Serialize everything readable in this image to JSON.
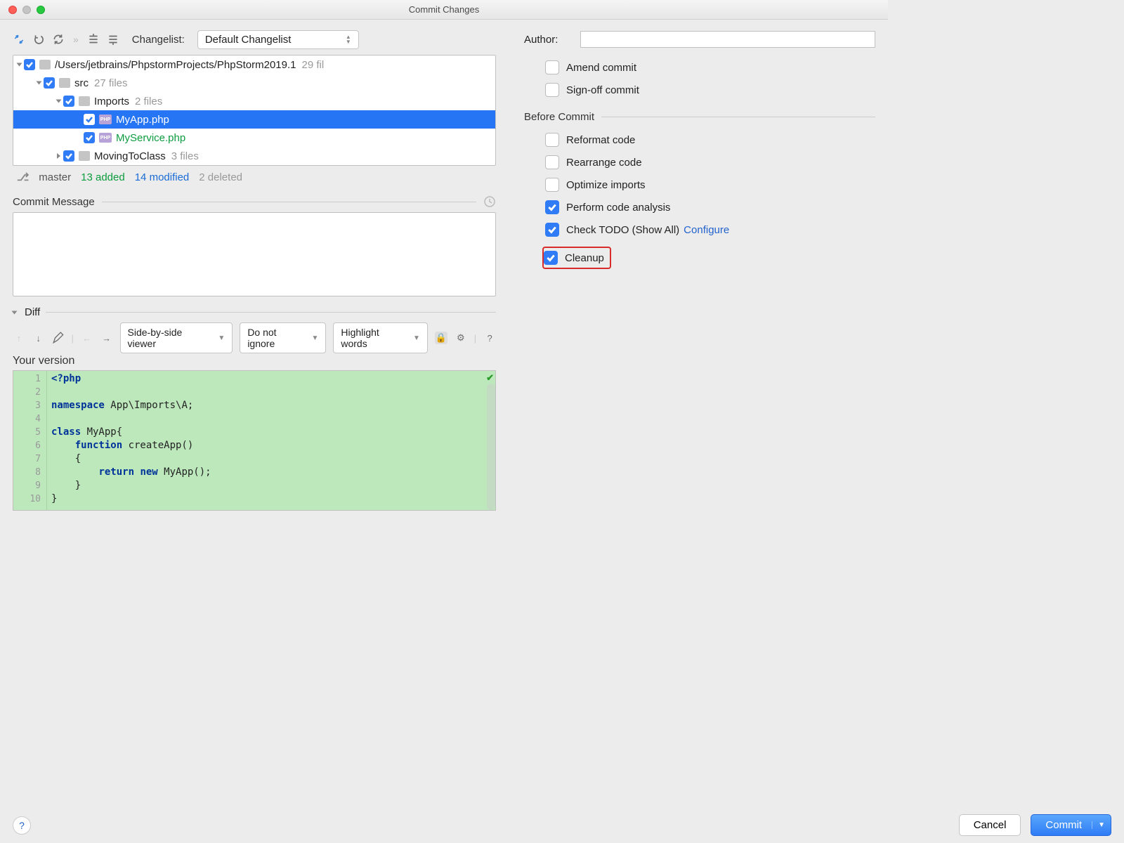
{
  "window": {
    "title": "Commit Changes"
  },
  "toolbar": {
    "changelist_label": "Changelist:",
    "changelist_value": "Default Changelist"
  },
  "tree": {
    "root": {
      "path": "/Users/jetbrains/PhpstormProjects/PhpStorm2019.1",
      "count": "29 fil"
    },
    "src": {
      "name": "src",
      "count": "27 files"
    },
    "imports": {
      "name": "Imports",
      "count": "2 files"
    },
    "file1": {
      "name": "MyApp.php"
    },
    "file2": {
      "name": "MyService.php"
    },
    "moving": {
      "name": "MovingToClass",
      "count": "3 files"
    }
  },
  "status": {
    "branch": "master",
    "added": "13 added",
    "modified": "14 modified",
    "deleted": "2 deleted"
  },
  "commit_msg": {
    "label": "Commit Message"
  },
  "diff": {
    "label": "Diff",
    "viewer": "Side-by-side viewer",
    "ignore": "Do not ignore",
    "highlight": "Highlight words",
    "your_version": "Your version"
  },
  "code": {
    "line_numbers": [
      "1",
      "2",
      "3",
      "4",
      "5",
      "6",
      "7",
      "8",
      "9",
      "10"
    ],
    "l1_kw": "<?php",
    "l3_kw": "namespace ",
    "l3_rest": "App\\Imports\\A;",
    "l5_kw": "class ",
    "l5_rest": "MyApp{",
    "l6_pad": "    ",
    "l6_kw": "function ",
    "l6_rest": "createApp()",
    "l7": "    {",
    "l8_pad": "        ",
    "l8_kw": "return new ",
    "l8_rest": "MyApp();",
    "l9": "    }",
    "l10": "}"
  },
  "right": {
    "author_label": "Author:",
    "amend": "Amend commit",
    "signoff": "Sign-off commit",
    "before_commit": "Before Commit",
    "reformat": "Reformat code",
    "rearrange": "Rearrange code",
    "optimize": "Optimize imports",
    "analysis": "Perform code analysis",
    "todo": "Check TODO (Show All)",
    "configure": "Configure",
    "cleanup": "Cleanup"
  },
  "buttons": {
    "cancel": "Cancel",
    "commit": "Commit"
  }
}
